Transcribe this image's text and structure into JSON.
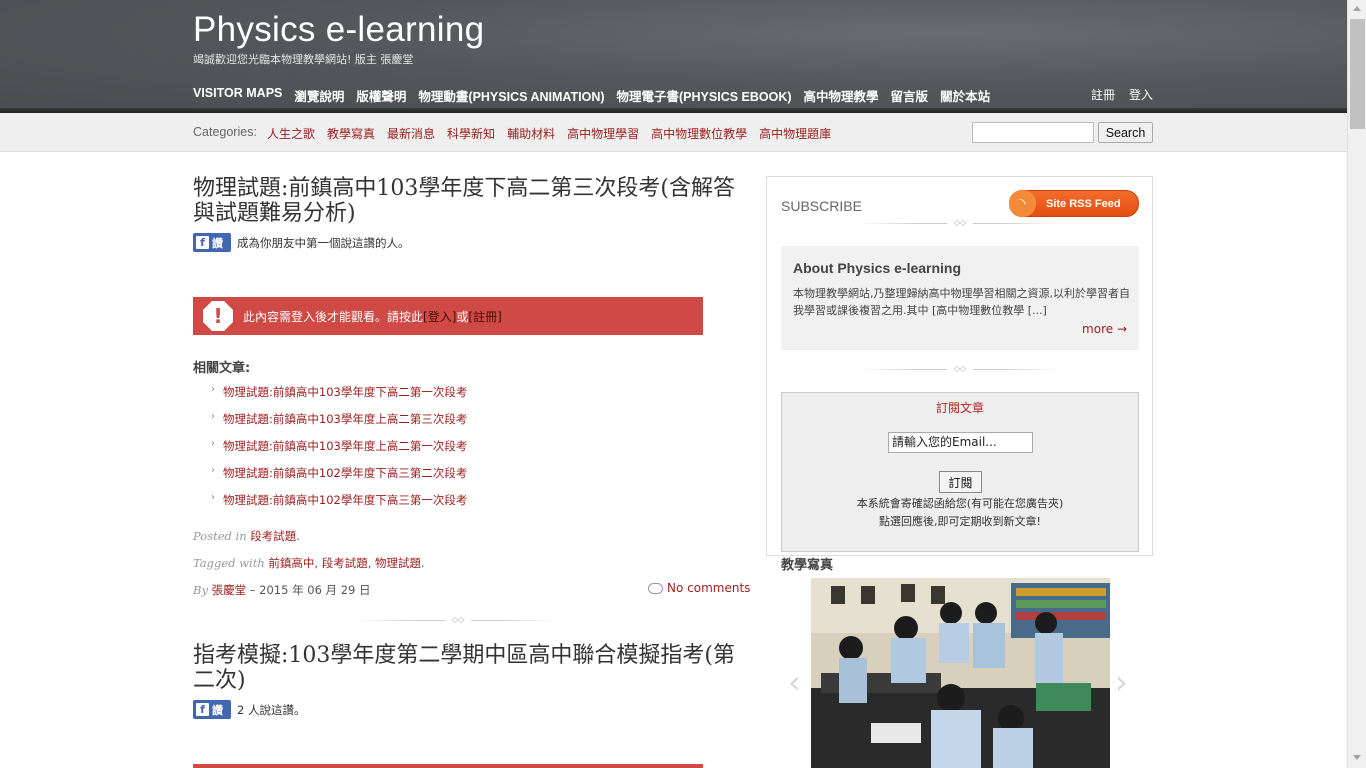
{
  "site": {
    "title": "Physics e-learning",
    "tagline": "竭誠歡迎您光臨本物理教學網站! 版主 張慶堂"
  },
  "nav": {
    "items": [
      "VISITOR MAPS",
      "瀏覽說明",
      "版權聲明",
      "物理動畫(PHYSICS ANIMATION)",
      "物理電子書(PHYSICS EBOOK)",
      "高中物理教學",
      "留言版",
      "關於本站"
    ],
    "register": "註冊",
    "login": "登入"
  },
  "categories": {
    "label": "Categories:",
    "items": [
      "人生之歌",
      "教學寫真",
      "最新消息",
      "科學新知",
      "輔助材料",
      "高中物理學習",
      "高中物理數位教學",
      "高中物理題庫"
    ]
  },
  "search": {
    "button": "Search",
    "value": ""
  },
  "post1": {
    "title": "物理試題:前鎮高中103學年度下高二第三次段考(含解答與試題難易分析)",
    "fb_like": "讚",
    "fb_text": "成為你朋友中第一個說這讚的人。",
    "login_notice": "此內容需登入後才能觀看。請按此",
    "login_link": "[登入]",
    "or": "或",
    "register_link": "[註冊]",
    "related_heading": "相關文章:",
    "related": [
      "物理試題:前鎮高中103學年度下高二第一次段考",
      "物理試題:前鎮高中103學年度上高二第三次段考",
      "物理試題:前鎮高中103學年度上高二第一次段考",
      "物理試題:前鎮高中102學年度下高三第二次段考",
      "物理試題:前鎮高中102學年度下高三第一次段考"
    ],
    "posted_in_label": "Posted in",
    "posted_in": "段考試題",
    "tagged_label": "Tagged with",
    "tags": [
      "前鎮高中",
      "段考試題",
      "物理試題"
    ],
    "by_label": "By",
    "author": "張慶堂",
    "date": " – 2015 年 06 月 29 日",
    "comments": "No comments"
  },
  "post2": {
    "title": "指考模擬:103學年度第二學期中區高中聯合模擬指考(第二次)",
    "fb_like": "讚",
    "fb_text": "2 人說這讚。"
  },
  "sidebar": {
    "subscribe": "SUBSCRIBE",
    "rss": "Site RSS Feed",
    "about_title": "About Physics e-learning",
    "about_text": "本物理教學網站,乃整理歸納高中物理學習相關之資源,以利於學習者自我學習或課後複習之用.其中 [高中物理數位教學 [...]",
    "about_more": "more →",
    "subform_title": "訂閱文章",
    "email_value": "請輸入您的Email...",
    "subscribe_btn": "訂閱",
    "note1": "本系統會寄確認函給您(有可能在您廣告夾)",
    "note2": "點選回應後,即可定期收到新文章!",
    "photo_heading": "教學寫真"
  },
  "colors": {
    "accent": "#9b1c1c",
    "alert": "#cf4a44",
    "header": "#55575c"
  }
}
